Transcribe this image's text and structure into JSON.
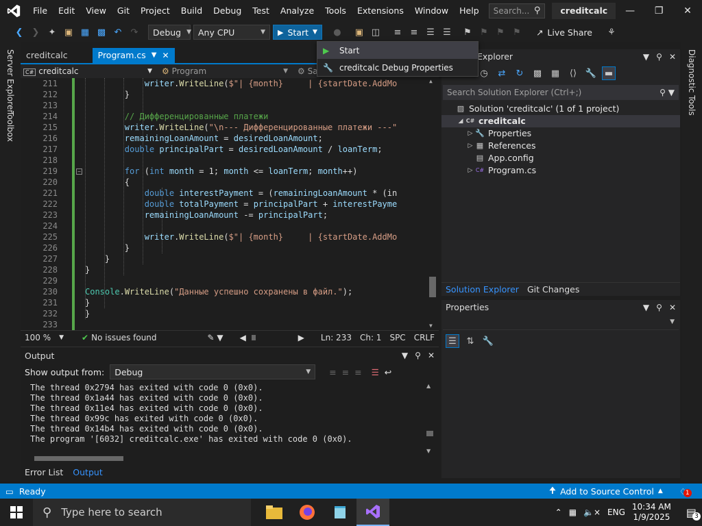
{
  "menu": {
    "items": [
      "File",
      "Edit",
      "View",
      "Git",
      "Project",
      "Build",
      "Debug",
      "Test",
      "Analyze",
      "Tools",
      "Extensions",
      "Window",
      "Help"
    ],
    "search_placeholder": "Search...",
    "project_name": "creditcalc"
  },
  "toolbar": {
    "config": "Debug",
    "platform": "Any CPU",
    "start_label": "Start",
    "live_share": "Live Share"
  },
  "dropdown": {
    "items": [
      "Start",
      "creditcalc Debug Properties"
    ]
  },
  "left_strip": {
    "server_explorer": "Server Explorer",
    "toolbox": "Toolbox"
  },
  "right_strip": {
    "diagnostic_tools": "Diagnostic Tools"
  },
  "editor": {
    "tabs": [
      "creditcalc",
      "Program.cs"
    ],
    "nav_project": "creditcalc",
    "nav_class": "Program",
    "nav_member": "Sa",
    "zoom": "100 %",
    "issues": "No issues found",
    "ln": "Ln: 233",
    "ch": "Ch: 1",
    "spc": "SPC",
    "crlf": "CRLF",
    "lines": [
      {
        "n": "211",
        "html": "            <span class=\"pm\">writer</span>.<span class=\"mt\">WriteLine</span>(<span class=\"str\">$\"| {month}     | {startDate.AddMo</span>"
      },
      {
        "n": "212",
        "html": "        }"
      },
      {
        "n": "213",
        "html": ""
      },
      {
        "n": "214",
        "html": "        <span class=\"cm\">// Дифференцированные платежи</span>"
      },
      {
        "n": "215",
        "html": "        <span class=\"pm\">writer</span>.<span class=\"mt\">WriteLine</span>(<span class=\"str\">\"\\n--- Дифференцированные платежи ---\"</span>"
      },
      {
        "n": "216",
        "html": "        <span class=\"pm\">remainingLoanAmount</span> = <span class=\"pm\">desiredLoanAmount</span>;"
      },
      {
        "n": "217",
        "html": "        <span class=\"kw\">double</span> <span class=\"pm\">principalPart</span> = <span class=\"pm\">desiredLoanAmount</span> / <span class=\"pm\">loanTerm</span>;"
      },
      {
        "n": "218",
        "html": ""
      },
      {
        "n": "219",
        "html": "        <span class=\"kw\">for</span> (<span class=\"kw\">int</span> <span class=\"pm\">month</span> = 1; <span class=\"pm\">month</span> &lt;= <span class=\"pm\">loanTerm</span>; <span class=\"pm\">month</span>++)"
      },
      {
        "n": "220",
        "html": "        {"
      },
      {
        "n": "221",
        "html": "            <span class=\"kw\">double</span> <span class=\"pm\">interestPayment</span> = (<span class=\"pm\">remainingLoanAmount</span> * (in"
      },
      {
        "n": "222",
        "html": "            <span class=\"kw\">double</span> <span class=\"pm\">totalPayment</span> = <span class=\"pm\">principalPart</span> + <span class=\"pm\">interestPayme</span>"
      },
      {
        "n": "223",
        "html": "            <span class=\"pm\">remainingLoanAmount</span> -= <span class=\"pm\">principalPart</span>;"
      },
      {
        "n": "224",
        "html": ""
      },
      {
        "n": "225",
        "html": "            <span class=\"pm\">writer</span>.<span class=\"mt\">WriteLine</span>(<span class=\"str\">$\"| {month}     | {startDate.AddMo</span>"
      },
      {
        "n": "226",
        "html": "        }"
      },
      {
        "n": "227",
        "html": "    }"
      },
      {
        "n": "228",
        "html": "}"
      },
      {
        "n": "229",
        "html": ""
      },
      {
        "n": "230",
        "html": "<span class=\"ty\">Console</span>.<span class=\"mt\">WriteLine</span>(<span class=\"str\">\"Данные успешно сохранены в файл.\"</span>);"
      },
      {
        "n": "231",
        "html": "}"
      },
      {
        "n": "232",
        "html": "}"
      },
      {
        "n": "233",
        "html": ""
      }
    ]
  },
  "output": {
    "title": "Output",
    "show_from_label": "Show output from:",
    "source": "Debug",
    "lines": [
      "The thread 0x2794 has exited with code 0 (0x0).",
      "The thread 0x1a44 has exited with code 0 (0x0).",
      "The thread 0x11e4 has exited with code 0 (0x0).",
      "The thread 0x99c has exited with code 0 (0x0).",
      "The thread 0x14b4 has exited with code 0 (0x0).",
      "The program '[6032] creditcalc.exe' has exited with code 0 (0x0)."
    ],
    "tabs": [
      "Error List",
      "Output"
    ]
  },
  "solution_explorer": {
    "title": "Explorer",
    "search_placeholder": "Search Solution Explorer (Ctrl+;)",
    "tree": [
      {
        "label": "Solution 'creditcalc' (1 of 1 project)",
        "icon": "solution-icon",
        "indent": 0
      },
      {
        "label": "creditcalc",
        "icon": "csharp-project-icon",
        "indent": 1,
        "selected": true
      },
      {
        "label": "Properties",
        "icon": "wrench-icon",
        "indent": 2
      },
      {
        "label": "References",
        "icon": "references-icon",
        "indent": 2
      },
      {
        "label": "App.config",
        "icon": "config-file-icon",
        "indent": 2
      },
      {
        "label": "Program.cs",
        "icon": "csharp-file-icon",
        "indent": 2
      }
    ],
    "tabs": [
      "Solution Explorer",
      "Git Changes"
    ]
  },
  "properties": {
    "title": "Properties"
  },
  "statusbar": {
    "ready": "Ready",
    "source_control": "Add to Source Control",
    "notif_count": "1"
  },
  "taskbar": {
    "search_placeholder": "Type here to search",
    "lang": "ENG",
    "time": "10:34 AM",
    "date": "1/9/2025",
    "notif_count": "3"
  },
  "colors": {
    "accent": "#007acc",
    "start_button": "#0e639c"
  }
}
